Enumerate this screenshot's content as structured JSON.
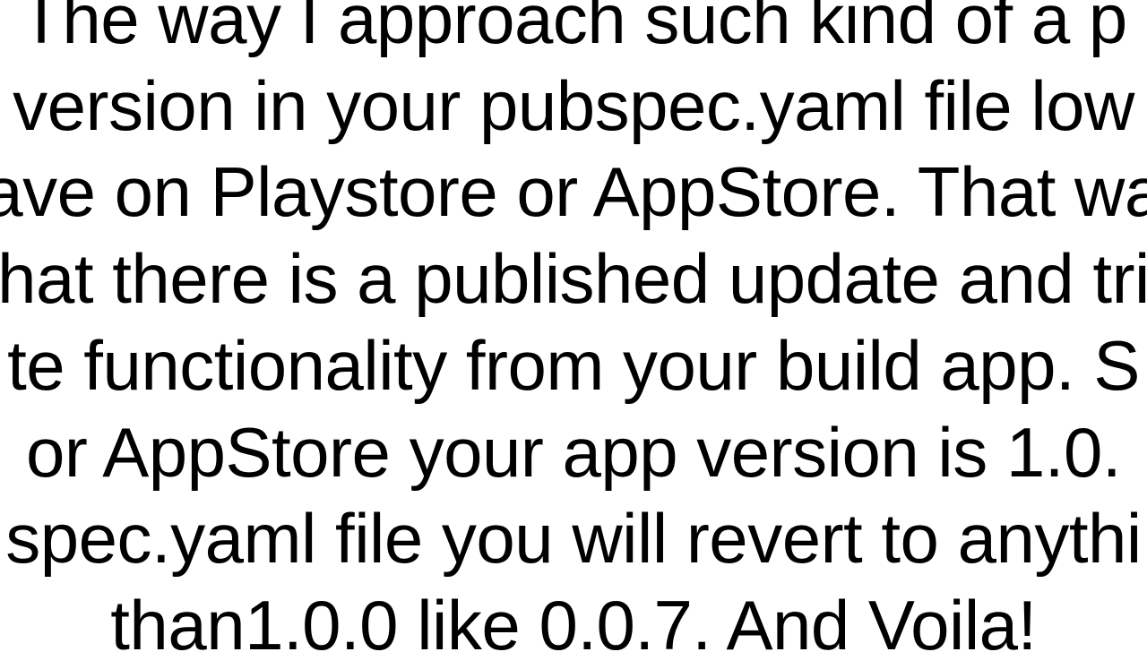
{
  "paragraph": {
    "line1": "The way I approach such kind of a p",
    "line2": "version in your pubspec.yaml file low",
    "line3": "ave on Playstore or AppStore. That wa",
    "line4": "hat there is a published update and tri",
    "line5": "te functionality from your build app.  S",
    "line6": " or AppStore your app version is 1.0.",
    "line7": "spec.yaml file you will revert to anythi",
    "line8": "than1.0.0 like 0.0.7. And Voila!"
  }
}
